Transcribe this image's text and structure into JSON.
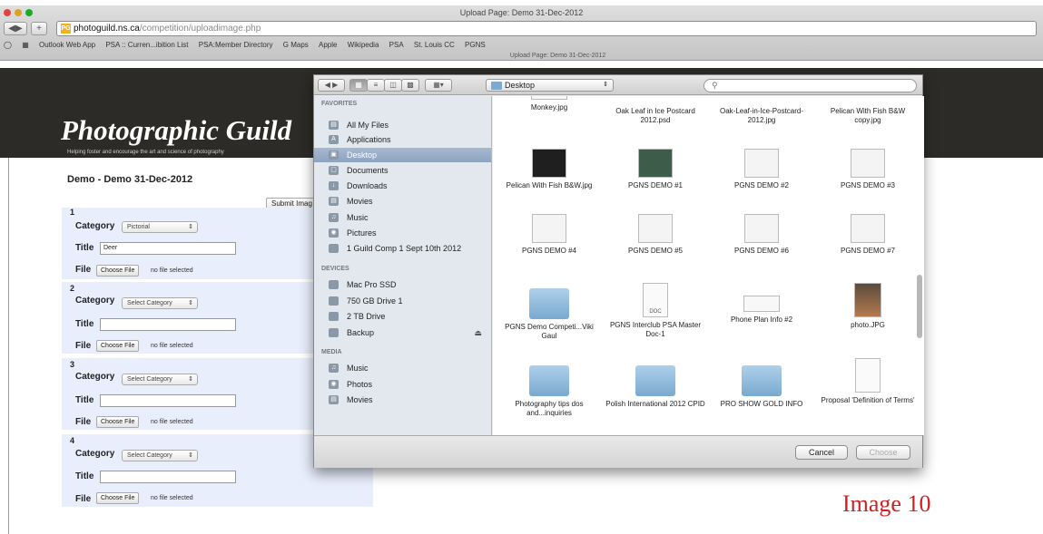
{
  "browser": {
    "window_title": "Upload Page: Demo 31-Dec-2012",
    "url_host": "photoguild.ns.ca",
    "url_path": "/competition/uploadimage.php",
    "favicon_text": "PG",
    "bookmarks": [
      "Outlook Web App",
      "PSA :: Curren...ibition List",
      "PSA:Member Directory",
      "G Maps",
      "Apple",
      "Wikipedia",
      "PSA",
      "St. Louis CC",
      "PGNS"
    ],
    "tab_title": "Upload Page: Demo 31-Dec-2012"
  },
  "site": {
    "logo": "Photographic Guild",
    "tagline": "Helping foster and encourage the art and science of photography"
  },
  "form": {
    "heading": "Demo - Demo 31-Dec-2012",
    "submit_label": "Submit Imag",
    "category_label": "Category",
    "title_label": "Title",
    "file_label": "File",
    "choose_file_label": "Choose File",
    "no_file_text": "no file selected",
    "entries": [
      {
        "number": "1",
        "category": "Pictorial",
        "title": "Deer"
      },
      {
        "number": "2",
        "category": "Select Category",
        "title": ""
      },
      {
        "number": "3",
        "category": "Select Category",
        "title": ""
      },
      {
        "number": "4",
        "category": "Select Category",
        "title": ""
      }
    ]
  },
  "dialog": {
    "location": "Desktop",
    "search_placeholder": "",
    "sidebar": {
      "favorites_heading": "FAVORITES",
      "favorites": [
        "All My Files",
        "Applications",
        "Desktop",
        "Documents",
        "Downloads",
        "Movies",
        "Music",
        "Pictures",
        "1 Guild Comp 1 Sept 10th 2012"
      ],
      "selected": "Desktop",
      "devices_heading": "DEVICES",
      "devices": [
        "Mac Pro SSD",
        "750 GB Drive 1",
        "2 TB Drive",
        "Backup"
      ],
      "media_heading": "MEDIA",
      "media": [
        "Music",
        "Photos",
        "Movies"
      ]
    },
    "files": [
      {
        "name": "Monkey.jpg",
        "kind": "wide"
      },
      {
        "name": "Oak Leaf in Ice Postcard 2012.psd",
        "kind": "none"
      },
      {
        "name": "Oak-Leaf-in-Ice-Postcard-2012.jpg",
        "kind": "none"
      },
      {
        "name": "Pelican With Fish B&W copy.jpg",
        "kind": "none"
      },
      {
        "name": "Pelican With Fish B&W.jpg",
        "kind": "dark"
      },
      {
        "name": "PGNS DEMO #1",
        "kind": "screen"
      },
      {
        "name": "PGNS DEMO #2",
        "kind": "screen"
      },
      {
        "name": "PGNS DEMO #3",
        "kind": "screen"
      },
      {
        "name": "PGNS DEMO #4",
        "kind": "screen"
      },
      {
        "name": "PGNS DEMO #5",
        "kind": "screen"
      },
      {
        "name": "PGNS DEMO #6",
        "kind": "screen"
      },
      {
        "name": "PGNS DEMO #7",
        "kind": "screen"
      },
      {
        "name": "PGNS Demo Competi...Viki Gaul",
        "kind": "folder"
      },
      {
        "name": "PGNS Interclub PSA Master Doc-1",
        "kind": "doc"
      },
      {
        "name": "Phone Plan Info #2",
        "kind": "wide"
      },
      {
        "name": "photo.JPG",
        "kind": "photo"
      },
      {
        "name": "Photography tips dos and...inquiries",
        "kind": "folder"
      },
      {
        "name": "Polish International 2012 CPID",
        "kind": "folder"
      },
      {
        "name": "PRO SHOW GOLD INFO",
        "kind": "folder"
      },
      {
        "name": "Proposal 'Definition of Terms'",
        "kind": "doc"
      }
    ],
    "doc_badge": "DOC",
    "cancel_label": "Cancel",
    "choose_label": "Choose"
  },
  "watermark": "Image 10",
  "icons": {
    "folder": "folder-icon",
    "search": "magnifier-icon",
    "eject": "eject-icon"
  }
}
